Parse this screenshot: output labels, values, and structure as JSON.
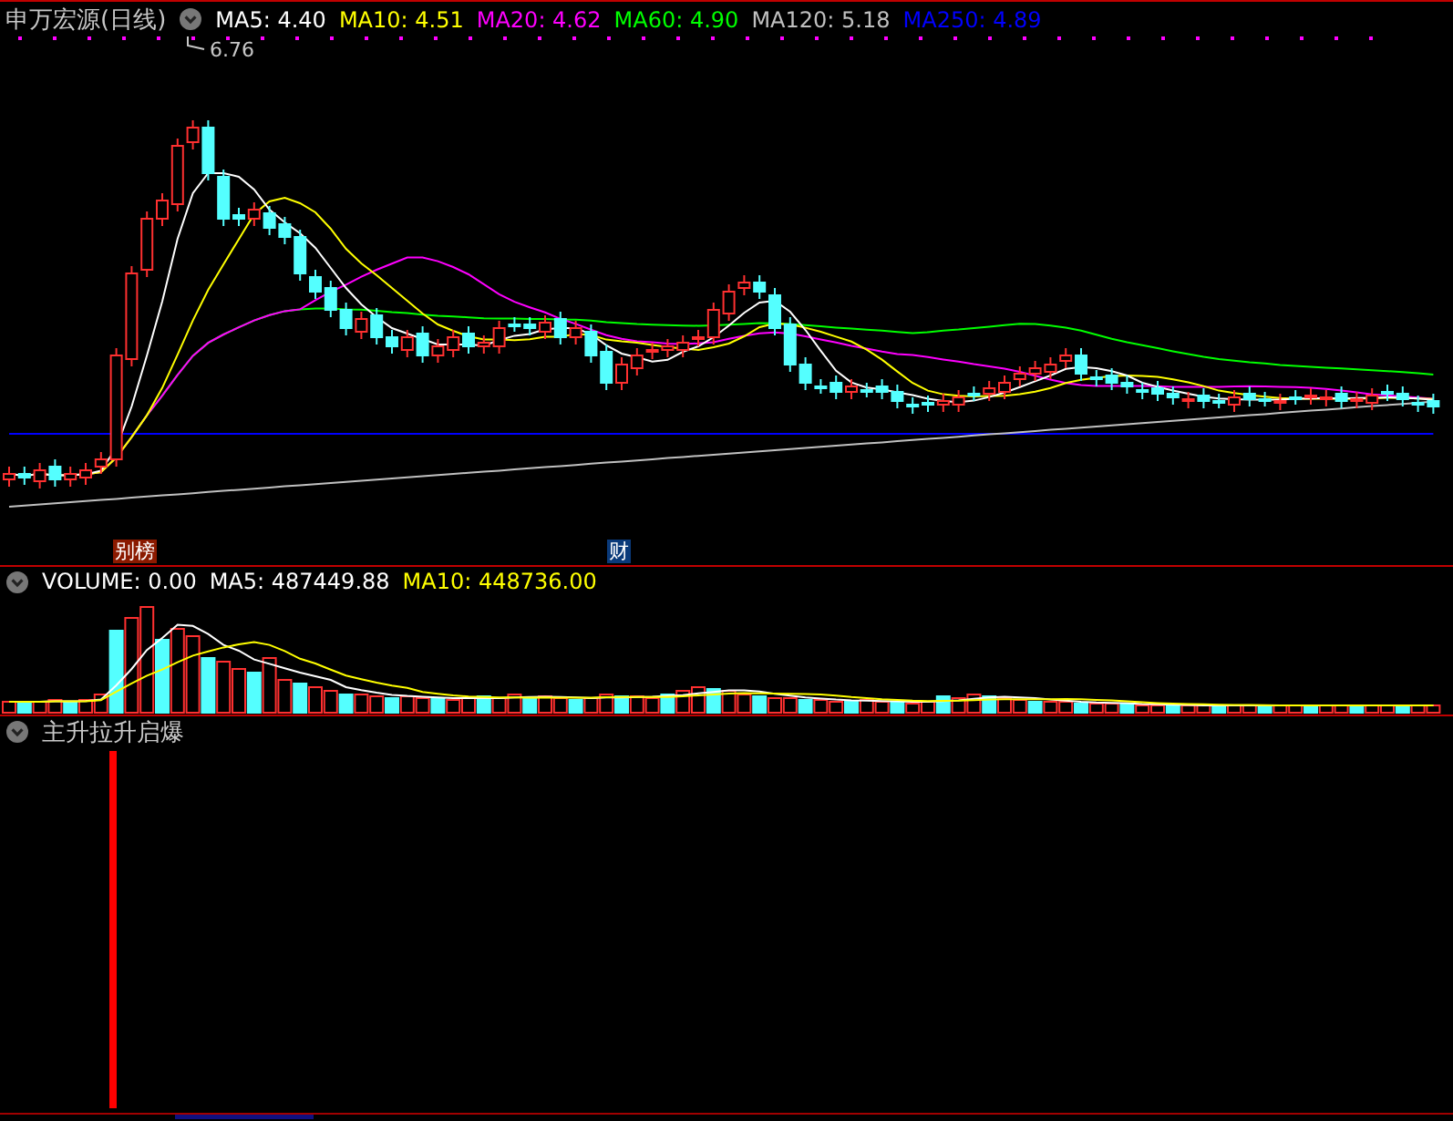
{
  "main_panel": {
    "title": "申万宏源(日线)",
    "indicators": [
      {
        "label": "MA5: 4.40",
        "color": "#ffffff"
      },
      {
        "label": "MA10: 4.51",
        "color": "#ffff00"
      },
      {
        "label": "MA20: 4.62",
        "color": "#ff00ff"
      },
      {
        "label": "MA60: 4.90",
        "color": "#00ff00"
      },
      {
        "label": "MA120: 5.18",
        "color": "#c0c0c0"
      },
      {
        "label": "MA250: 4.89",
        "color": "#0000ff"
      }
    ],
    "high_label": "6.76",
    "markers": [
      {
        "label": "别榜",
        "color": "#8b1a00"
      },
      {
        "label": "财",
        "color": "#0a3a7a"
      }
    ]
  },
  "volume_panel": {
    "indicators": [
      {
        "label": "VOLUME: 0.00",
        "color": "#ffffff"
      },
      {
        "label": "MA5: 487449.88",
        "color": "#ffffff"
      },
      {
        "label": "MA10: 448736.00",
        "color": "#ffff00"
      }
    ]
  },
  "signal_panel": {
    "title": "主升拉升启爆"
  }
}
